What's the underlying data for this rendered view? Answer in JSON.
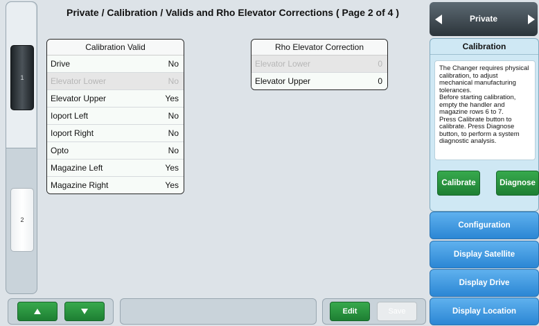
{
  "header": {
    "title": "Private / Calibration / Valids and Rho Elevator Corrections ( Page 2 of 4 )"
  },
  "pages": {
    "current": "1",
    "other": "2"
  },
  "calibration_valid": {
    "title": "Calibration Valid",
    "rows": [
      {
        "label": "Drive",
        "value": "No",
        "enabled": true
      },
      {
        "label": "Elevator Lower",
        "value": "No",
        "enabled": false
      },
      {
        "label": "Elevator Upper",
        "value": "Yes",
        "enabled": true
      },
      {
        "label": "Ioport Left",
        "value": "No",
        "enabled": true
      },
      {
        "label": "Ioport Right",
        "value": "No",
        "enabled": true
      },
      {
        "label": "Opto",
        "value": "No",
        "enabled": true
      },
      {
        "label": "Magazine Left",
        "value": "Yes",
        "enabled": true
      },
      {
        "label": "Magazine Right",
        "value": "Yes",
        "enabled": true
      }
    ]
  },
  "rho_correction": {
    "title": "Rho Elevator Correction",
    "rows": [
      {
        "label": "Elevator Lower",
        "value": "0",
        "enabled": false
      },
      {
        "label": "Elevator Upper",
        "value": "0",
        "enabled": true
      }
    ]
  },
  "bottom_bar": {
    "up_icon": "up-triangle-icon",
    "down_icon": "down-triangle-icon",
    "edit_label": "Edit",
    "save_label": "Save"
  },
  "right_panel": {
    "nav_title": "Private",
    "info_title": "Calibration",
    "info_text": "   The Changer requires physical calibration, to adjust mechanical manufacturing tolerances.\n   Before starting calibration, empty the handler and magazine rows 6 to 7.\n   Press Calibrate button to calibrate.  Press Diagnose button, to perform a system diagnostic analysis.",
    "calibrate_label": "Calibrate",
    "diagnose_label": "Diagnose",
    "nav_buttons": [
      "Configuration",
      "Display Satellite",
      "Display Drive",
      "Display Location"
    ]
  },
  "colors": {
    "accent_green": "#2e9a45",
    "accent_blue": "#3f98e0",
    "header_dark": "#3a444b"
  }
}
